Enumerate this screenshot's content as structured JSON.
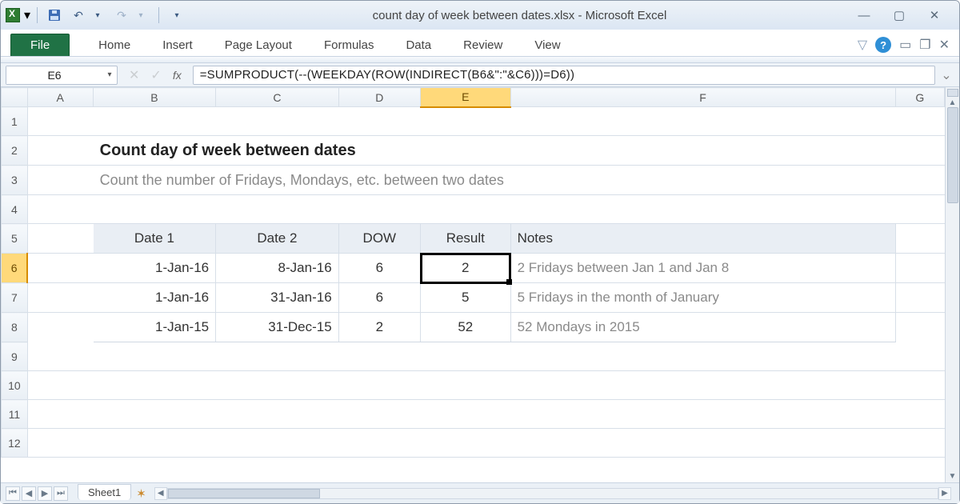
{
  "title": "count day of week between dates.xlsx - Microsoft Excel",
  "ribbon": {
    "file": "File",
    "tabs": [
      "Home",
      "Insert",
      "Page Layout",
      "Formulas",
      "Data",
      "Review",
      "View"
    ]
  },
  "namebox": "E6",
  "formula": "=SUMPRODUCT(--(WEEKDAY(ROW(INDIRECT(B6&\":\"&C6)))=D6))",
  "columns": [
    "A",
    "B",
    "C",
    "D",
    "E",
    "F",
    "G"
  ],
  "rows": [
    "1",
    "2",
    "3",
    "4",
    "5",
    "6",
    "7",
    "8",
    "9",
    "10",
    "11",
    "12"
  ],
  "selected": {
    "col": "E",
    "row": "6"
  },
  "content": {
    "title": "Count day of week between dates",
    "subtitle": "Count the number of Fridays, Mondays, etc. between two dates",
    "headers": {
      "b": "Date 1",
      "c": "Date 2",
      "d": "DOW",
      "e": "Result",
      "f": "Notes"
    },
    "data": [
      {
        "b": "1-Jan-16",
        "c": "8-Jan-16",
        "d": "6",
        "e": "2",
        "f": "2 Fridays between Jan 1 and Jan 8"
      },
      {
        "b": "1-Jan-16",
        "c": "31-Jan-16",
        "d": "6",
        "e": "5",
        "f": "5 Fridays in the month of January"
      },
      {
        "b": "1-Jan-15",
        "c": "31-Dec-15",
        "d": "2",
        "e": "52",
        "f": "52 Mondays in 2015"
      }
    ]
  },
  "sheet_tab": "Sheet1"
}
